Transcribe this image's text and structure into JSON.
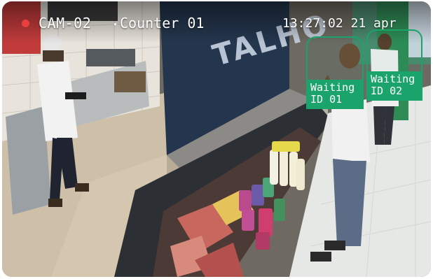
{
  "overlay": {
    "camera_label": "CAM-02",
    "counter_label": "Counter 01",
    "timestamp": "13:27:02 21 apr",
    "recording_color": "#e8403d"
  },
  "scene": {
    "wall_sign": "TALHO"
  },
  "detections": [
    {
      "label": "Waiting\nID 01",
      "color": "#1aa36a"
    },
    {
      "label": "Waiting\nID 02",
      "color": "#1aa36a"
    }
  ]
}
